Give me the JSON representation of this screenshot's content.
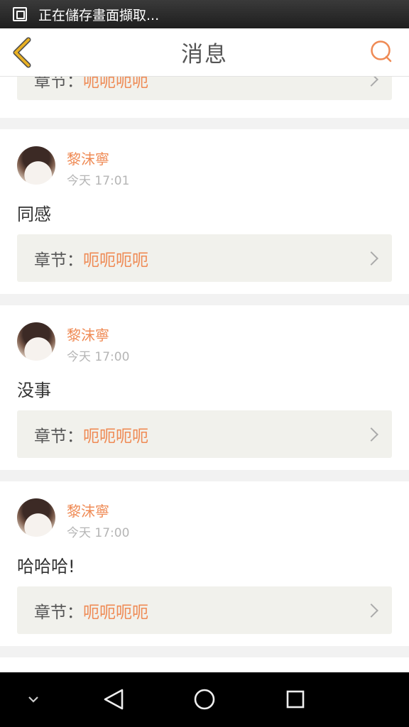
{
  "status_bar": {
    "text": "正在儲存畫面擷取..."
  },
  "header": {
    "title": "消息"
  },
  "partial_item": {
    "chapter_label": "章节：",
    "chapter_value": "呃呃呃呃"
  },
  "messages": [
    {
      "username": "黎沫寧",
      "time": "今天 17:01",
      "text": "同感",
      "chapter_label": "章节：",
      "chapter_value": "呃呃呃呃"
    },
    {
      "username": "黎沫寧",
      "time": "今天 17:00",
      "text": "没事",
      "chapter_label": "章节：",
      "chapter_value": "呃呃呃呃"
    },
    {
      "username": "黎沫寧",
      "time": "今天 17:00",
      "text": "哈哈哈!",
      "chapter_label": "章节：",
      "chapter_value": "呃呃呃呃"
    }
  ],
  "icons": {
    "back": "chevron-left-icon",
    "search": "search-icon",
    "nav_down": "chevron-down-icon",
    "nav_back": "triangle-back-icon",
    "nav_home": "circle-home-icon",
    "nav_recent": "square-recent-icon"
  },
  "colors": {
    "accent": "#ef8a54",
    "back_arrow": "#e8b023",
    "chapter_bg": "#f1f1ec"
  }
}
